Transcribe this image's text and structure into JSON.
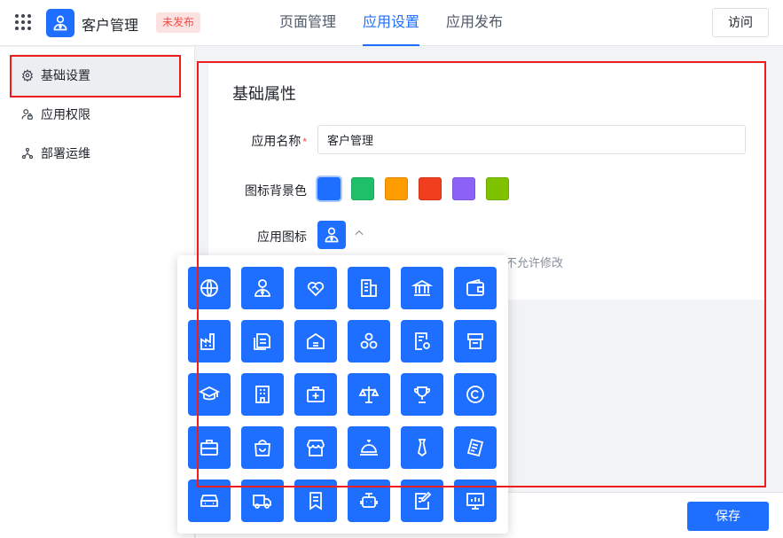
{
  "header": {
    "app_name": "客户管理",
    "status_badge": "未发布",
    "tabs": [
      "页面管理",
      "应用设置",
      "应用发布"
    ],
    "active_tab": "应用设置",
    "visit_button": "访问"
  },
  "sidebar": {
    "items": [
      {
        "label": "基础设置",
        "icon": "gear-icon",
        "active": true
      },
      {
        "label": "应用权限",
        "icon": "user-lock-icon",
        "active": false
      },
      {
        "label": "部署运维",
        "icon": "network-nodes-icon",
        "active": false
      }
    ]
  },
  "form": {
    "section_title": "基础属性",
    "name_label": "应用名称",
    "required_mark": "*",
    "name_value": "客户管理",
    "bg_color_label": "图标背景色",
    "bg_colors": [
      "#1e6fff",
      "#1fbf6a",
      "#ff9d00",
      "#f03e1e",
      "#8b62f5",
      "#7fc200"
    ],
    "selected_bg_color": "#1e6fff",
    "icon_label": "应用图标",
    "hint_text": "不允许修改"
  },
  "icon_picker": {
    "icons": [
      "globe-icon",
      "person-tie-icon",
      "handshake-heart-icon",
      "buildings-icon",
      "bank-icon",
      "wallet-icon",
      "factory-icon",
      "documents-icon",
      "warehouse-icon",
      "three-circles-icon",
      "settings-doc-icon",
      "cash-register-icon",
      "graduation-cap-icon",
      "hospital-icon",
      "medical-kit-icon",
      "scales-icon",
      "trophy-icon",
      "copyright-icon",
      "briefcase-icon",
      "shopping-bag-icon",
      "store-icon",
      "service-bell-icon",
      "necktie-icon",
      "receipt-icon",
      "car-icon",
      "truck-icon",
      "bookmark-doc-icon",
      "robot-icon",
      "edit-doc-icon",
      "chart-monitor-icon"
    ]
  },
  "footer": {
    "save_button": "保存"
  }
}
